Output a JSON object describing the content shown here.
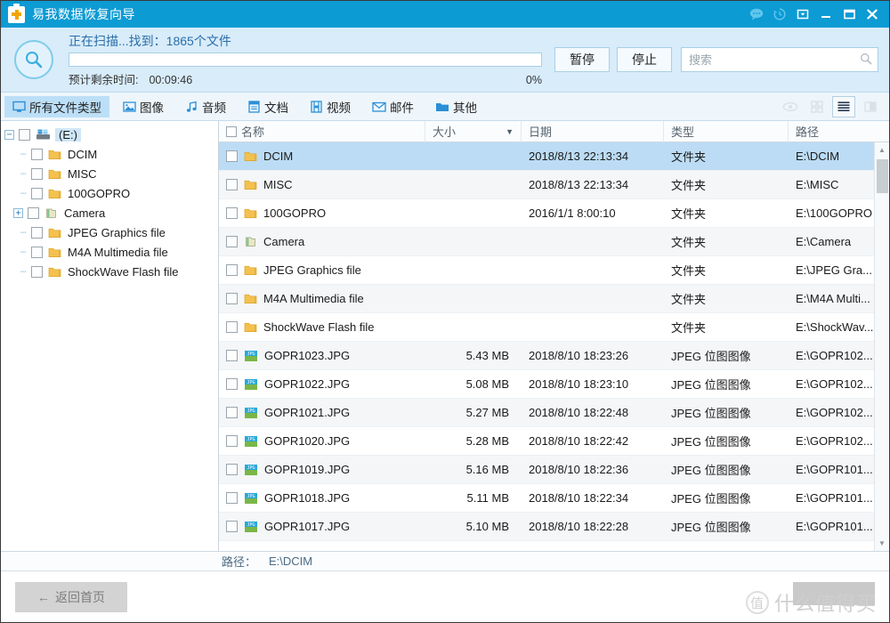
{
  "window": {
    "title": "易我数据恢复向导",
    "icon": "medkit-icon",
    "controls": [
      {
        "name": "feedback-chat-icon",
        "glyph": "chat"
      },
      {
        "name": "history-clock-icon",
        "glyph": "clock"
      },
      {
        "name": "menu-dropdown-icon",
        "glyph": "dropdown"
      },
      {
        "name": "minimize-button",
        "glyph": "minimize"
      },
      {
        "name": "maximize-button",
        "glyph": "maximize"
      },
      {
        "name": "close-button",
        "glyph": "close"
      }
    ]
  },
  "scan": {
    "icon": "magnifier-icon",
    "status_prefix": "正在扫描...找到：",
    "found_text": "1865个文件",
    "progress_percent": 0,
    "percent_label": "0%",
    "eta_label": "预计剩余时间:",
    "eta_value": "00:09:46",
    "pause_label": "暂停",
    "stop_label": "停止",
    "search_placeholder": "搜索",
    "search_value": ""
  },
  "tabs": [
    {
      "label": "所有文件类型",
      "icon": "monitor-icon",
      "active": true
    },
    {
      "label": "图像",
      "icon": "image-icon",
      "active": false
    },
    {
      "label": "音频",
      "icon": "music-note-icon",
      "active": false
    },
    {
      "label": "文档",
      "icon": "document-icon",
      "active": false
    },
    {
      "label": "视频",
      "icon": "film-icon",
      "active": false
    },
    {
      "label": "邮件",
      "icon": "envelope-icon",
      "active": false
    },
    {
      "label": "其他",
      "icon": "folder-icon",
      "active": false
    }
  ],
  "view_controls": [
    {
      "name": "preview-eye-icon",
      "state": "disabled"
    },
    {
      "name": "thumbnail-grid-icon",
      "state": "disabled"
    },
    {
      "name": "list-view-icon",
      "state": "selected"
    },
    {
      "name": "detail-pane-icon",
      "state": "disabled"
    }
  ],
  "tree": {
    "root": {
      "label": "(E:)",
      "icon": "drive-icon",
      "expander": "−",
      "selected": true,
      "checked": false
    },
    "children": [
      {
        "label": "DCIM",
        "icon": "folder-icon",
        "expander": "",
        "checked": false
      },
      {
        "label": "MISC",
        "icon": "folder-icon",
        "expander": "",
        "checked": false
      },
      {
        "label": "100GOPRO",
        "icon": "folder-icon",
        "expander": "",
        "checked": false
      },
      {
        "label": "Camera",
        "icon": "folder-green-icon",
        "expander": "+",
        "checked": false
      },
      {
        "label": "JPEG Graphics file",
        "icon": "folder-icon",
        "expander": "",
        "checked": false
      },
      {
        "label": "M4A Multimedia file",
        "icon": "folder-icon",
        "expander": "",
        "checked": false
      },
      {
        "label": "ShockWave Flash file",
        "icon": "folder-icon",
        "expander": "",
        "checked": false
      }
    ]
  },
  "table": {
    "columns": [
      {
        "key": "name",
        "label": "名称",
        "has_checkbox": true
      },
      {
        "key": "size",
        "label": "大小",
        "sorted": true,
        "sort_glyph": "▼"
      },
      {
        "key": "date",
        "label": "日期"
      },
      {
        "key": "type",
        "label": "类型"
      },
      {
        "key": "path",
        "label": "路径"
      }
    ],
    "rows": [
      {
        "name": "DCIM",
        "icon": "folder-icon",
        "size": "",
        "date": "2018/8/13 22:13:34",
        "type": "文件夹",
        "path": "E:\\DCIM",
        "selected": true
      },
      {
        "name": "MISC",
        "icon": "folder-icon",
        "size": "",
        "date": "2018/8/13 22:13:34",
        "type": "文件夹",
        "path": "E:\\MISC",
        "selected": false
      },
      {
        "name": "100GOPRO",
        "icon": "folder-icon",
        "size": "",
        "date": "2016/1/1 8:00:10",
        "type": "文件夹",
        "path": "E:\\100GOPRO",
        "selected": false
      },
      {
        "name": "Camera",
        "icon": "folder-green-icon",
        "size": "",
        "date": "",
        "type": "文件夹",
        "path": "E:\\Camera",
        "selected": false
      },
      {
        "name": "JPEG Graphics file",
        "icon": "folder-icon",
        "size": "",
        "date": "",
        "type": "文件夹",
        "path": "E:\\JPEG Gra...",
        "selected": false
      },
      {
        "name": "M4A Multimedia file",
        "icon": "folder-icon",
        "size": "",
        "date": "",
        "type": "文件夹",
        "path": "E:\\M4A Multi...",
        "selected": false
      },
      {
        "name": "ShockWave Flash file",
        "icon": "folder-icon",
        "size": "",
        "date": "",
        "type": "文件夹",
        "path": "E:\\ShockWav...",
        "selected": false
      },
      {
        "name": "GOPR1023.JPG",
        "icon": "jpg-file-icon",
        "size": "5.43 MB",
        "date": "2018/8/10 18:23:26",
        "type": "JPEG 位图图像",
        "path": "E:\\GOPR102...",
        "selected": false
      },
      {
        "name": "GOPR1022.JPG",
        "icon": "jpg-file-icon",
        "size": "5.08 MB",
        "date": "2018/8/10 18:23:10",
        "type": "JPEG 位图图像",
        "path": "E:\\GOPR102...",
        "selected": false
      },
      {
        "name": "GOPR1021.JPG",
        "icon": "jpg-file-icon",
        "size": "5.27 MB",
        "date": "2018/8/10 18:22:48",
        "type": "JPEG 位图图像",
        "path": "E:\\GOPR102...",
        "selected": false
      },
      {
        "name": "GOPR1020.JPG",
        "icon": "jpg-file-icon",
        "size": "5.28 MB",
        "date": "2018/8/10 18:22:42",
        "type": "JPEG 位图图像",
        "path": "E:\\GOPR102...",
        "selected": false
      },
      {
        "name": "GOPR1019.JPG",
        "icon": "jpg-file-icon",
        "size": "5.16 MB",
        "date": "2018/8/10 18:22:36",
        "type": "JPEG 位图图像",
        "path": "E:\\GOPR101...",
        "selected": false
      },
      {
        "name": "GOPR1018.JPG",
        "icon": "jpg-file-icon",
        "size": "5.11 MB",
        "date": "2018/8/10 18:22:34",
        "type": "JPEG 位图图像",
        "path": "E:\\GOPR101...",
        "selected": false
      },
      {
        "name": "GOPR1017.JPG",
        "icon": "jpg-file-icon",
        "size": "5.10 MB",
        "date": "2018/8/10 18:22:28",
        "type": "JPEG 位图图像",
        "path": "E:\\GOPR101...",
        "selected": false
      }
    ]
  },
  "statusbar": {
    "path_label": "路径：",
    "path_value": "E:\\DCIM"
  },
  "footer": {
    "back_label": "返回首页",
    "back_arrow": "←"
  },
  "watermark": {
    "mark": "值",
    "text": "什么值得买"
  },
  "colors": {
    "title_bar": "#0d9bd4",
    "scan_panel": "#d8ecfa",
    "accent": "#49b4e8",
    "row_selected": "#bcdcf5",
    "tab_active": "#bcdff7"
  }
}
